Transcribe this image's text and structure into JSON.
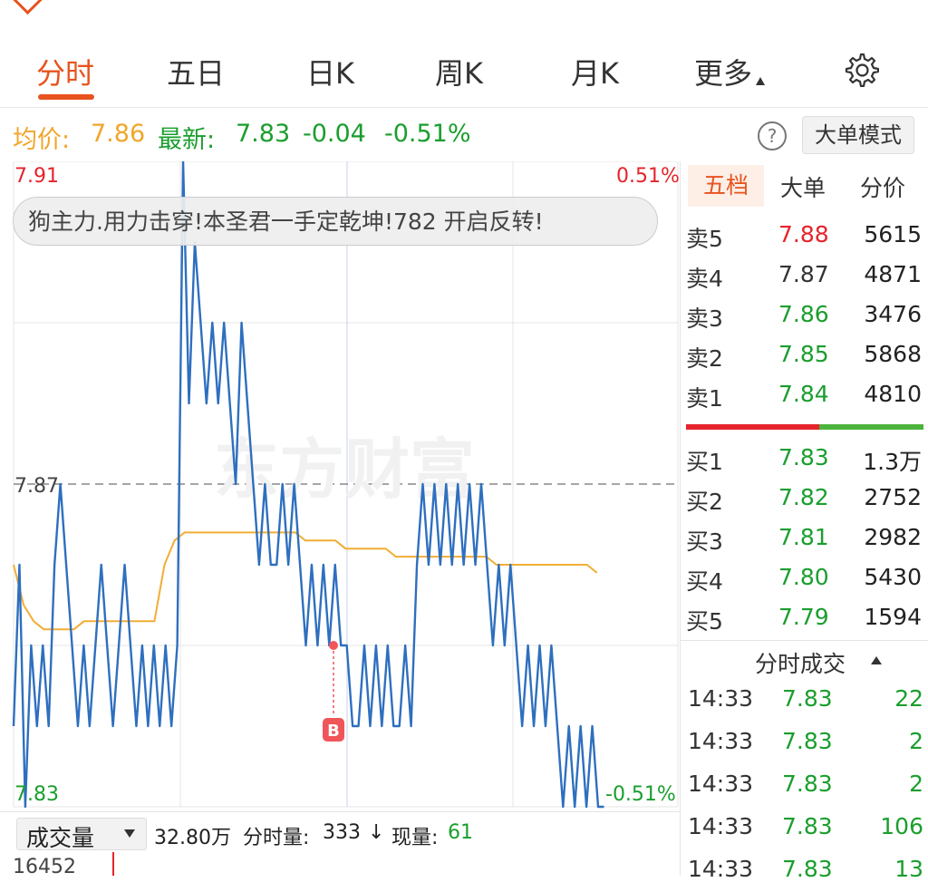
{
  "tabs": [
    {
      "label": "分时",
      "active": true
    },
    {
      "label": "五日"
    },
    {
      "label": "日K"
    },
    {
      "label": "周K"
    },
    {
      "label": "月K"
    },
    {
      "label": "更多"
    }
  ],
  "info": {
    "avg_label": "均价:",
    "avg_value": "7.86",
    "latest_label": "最新:",
    "latest_value": "7.83",
    "change": "-0.04",
    "change_pct": "-0.51%",
    "help_icon": "?",
    "mode_button": "大单模式"
  },
  "comment": "狗主力.用力击穿!本圣君一手定乾坤!782 开启反转!",
  "chart_data": {
    "type": "line",
    "ylim": [
      7.83,
      7.91
    ],
    "ref_price": 7.87,
    "labels": {
      "top_left": "7.91",
      "top_right": "0.51%",
      "mid_left": "7.87",
      "bottom_left": "7.83",
      "bottom_right": "-0.51%"
    },
    "price": [
      7.84,
      7.86,
      7.83,
      7.85,
      7.84,
      7.85,
      7.84,
      7.86,
      7.87,
      7.86,
      7.85,
      7.84,
      7.85,
      7.84,
      7.85,
      7.86,
      7.85,
      7.84,
      7.85,
      7.86,
      7.85,
      7.84,
      7.85,
      7.84,
      7.85,
      7.84,
      7.85,
      7.84,
      7.85,
      7.91,
      7.88,
      7.9,
      7.89,
      7.88,
      7.89,
      7.88,
      7.89,
      7.88,
      7.87,
      7.89,
      7.88,
      7.87,
      7.86,
      7.87,
      7.86,
      7.86,
      7.87,
      7.86,
      7.87,
      7.86,
      7.85,
      7.86,
      7.85,
      7.86,
      7.85,
      7.86,
      7.85,
      7.85,
      7.84,
      7.84,
      7.85,
      7.84,
      7.85,
      7.84,
      7.85,
      7.84,
      7.84,
      7.85,
      7.84,
      7.86,
      7.87,
      7.86,
      7.87,
      7.86,
      7.87,
      7.86,
      7.87,
      7.86,
      7.87,
      7.86,
      7.87,
      7.86,
      7.85,
      7.86,
      7.85,
      7.86,
      7.85,
      7.84,
      7.85,
      7.84,
      7.85,
      7.84,
      7.85,
      7.84,
      7.83,
      7.84,
      7.83,
      7.84,
      7.83,
      7.84,
      7.83,
      7.83
    ],
    "avg_line": [
      7.86,
      7.855,
      7.853,
      7.852,
      7.852,
      7.852,
      7.852,
      7.853,
      7.853,
      7.853,
      7.853,
      7.853,
      7.853,
      7.853,
      7.853,
      7.86,
      7.863,
      7.864,
      7.864,
      7.864,
      7.864,
      7.864,
      7.864,
      7.864,
      7.864,
      7.864,
      7.864,
      7.864,
      7.864,
      7.863,
      7.863,
      7.863,
      7.863,
      7.862,
      7.862,
      7.862,
      7.862,
      7.862,
      7.861,
      7.861,
      7.861,
      7.861,
      7.861,
      7.861,
      7.861,
      7.861,
      7.861,
      7.861,
      7.86,
      7.86,
      7.86,
      7.86,
      7.86,
      7.86,
      7.86,
      7.86,
      7.86,
      7.86,
      7.859
    ],
    "marker": {
      "label": "B",
      "price": 7.85
    }
  },
  "volume": {
    "selector_label": "成交量",
    "total": "32.80万",
    "fs_label": "分时量:",
    "fs_value": "333",
    "arrow": "↓",
    "now_label": "现量:",
    "now_value": "61",
    "max_label": "16452"
  },
  "watermark": "东方财富",
  "order_book": {
    "tabs": [
      "五档",
      "大单",
      "分价"
    ],
    "sells": [
      {
        "label": "卖5",
        "price": "7.88",
        "volume": "5615",
        "color": "#e5242b"
      },
      {
        "label": "卖4",
        "price": "7.87",
        "volume": "4871",
        "color": "#333333"
      },
      {
        "label": "卖3",
        "price": "7.86",
        "volume": "3476",
        "color": "#1a9e2e"
      },
      {
        "label": "卖2",
        "price": "7.85",
        "volume": "5868",
        "color": "#1a9e2e"
      },
      {
        "label": "卖1",
        "price": "7.84",
        "volume": "4810",
        "color": "#1a9e2e"
      }
    ],
    "buy_ratio": 0.44,
    "buys": [
      {
        "label": "买1",
        "price": "7.83",
        "volume": "1.3万",
        "color": "#1a9e2e"
      },
      {
        "label": "买2",
        "price": "7.82",
        "volume": "2752",
        "color": "#1a9e2e"
      },
      {
        "label": "买3",
        "price": "7.81",
        "volume": "2982",
        "color": "#1a9e2e"
      },
      {
        "label": "买4",
        "price": "7.80",
        "volume": "5430",
        "color": "#1a9e2e"
      },
      {
        "label": "买5",
        "price": "7.79",
        "volume": "1594",
        "color": "#1a9e2e"
      }
    ]
  },
  "ticks": {
    "title": "分时成交",
    "rows": [
      {
        "time": "14:33",
        "price": "7.83",
        "volume": "22"
      },
      {
        "time": "14:33",
        "price": "7.83",
        "volume": "2"
      },
      {
        "time": "14:33",
        "price": "7.83",
        "volume": "2"
      },
      {
        "time": "14:33",
        "price": "7.83",
        "volume": "106"
      },
      {
        "time": "14:33",
        "price": "7.83",
        "volume": "13"
      }
    ]
  }
}
